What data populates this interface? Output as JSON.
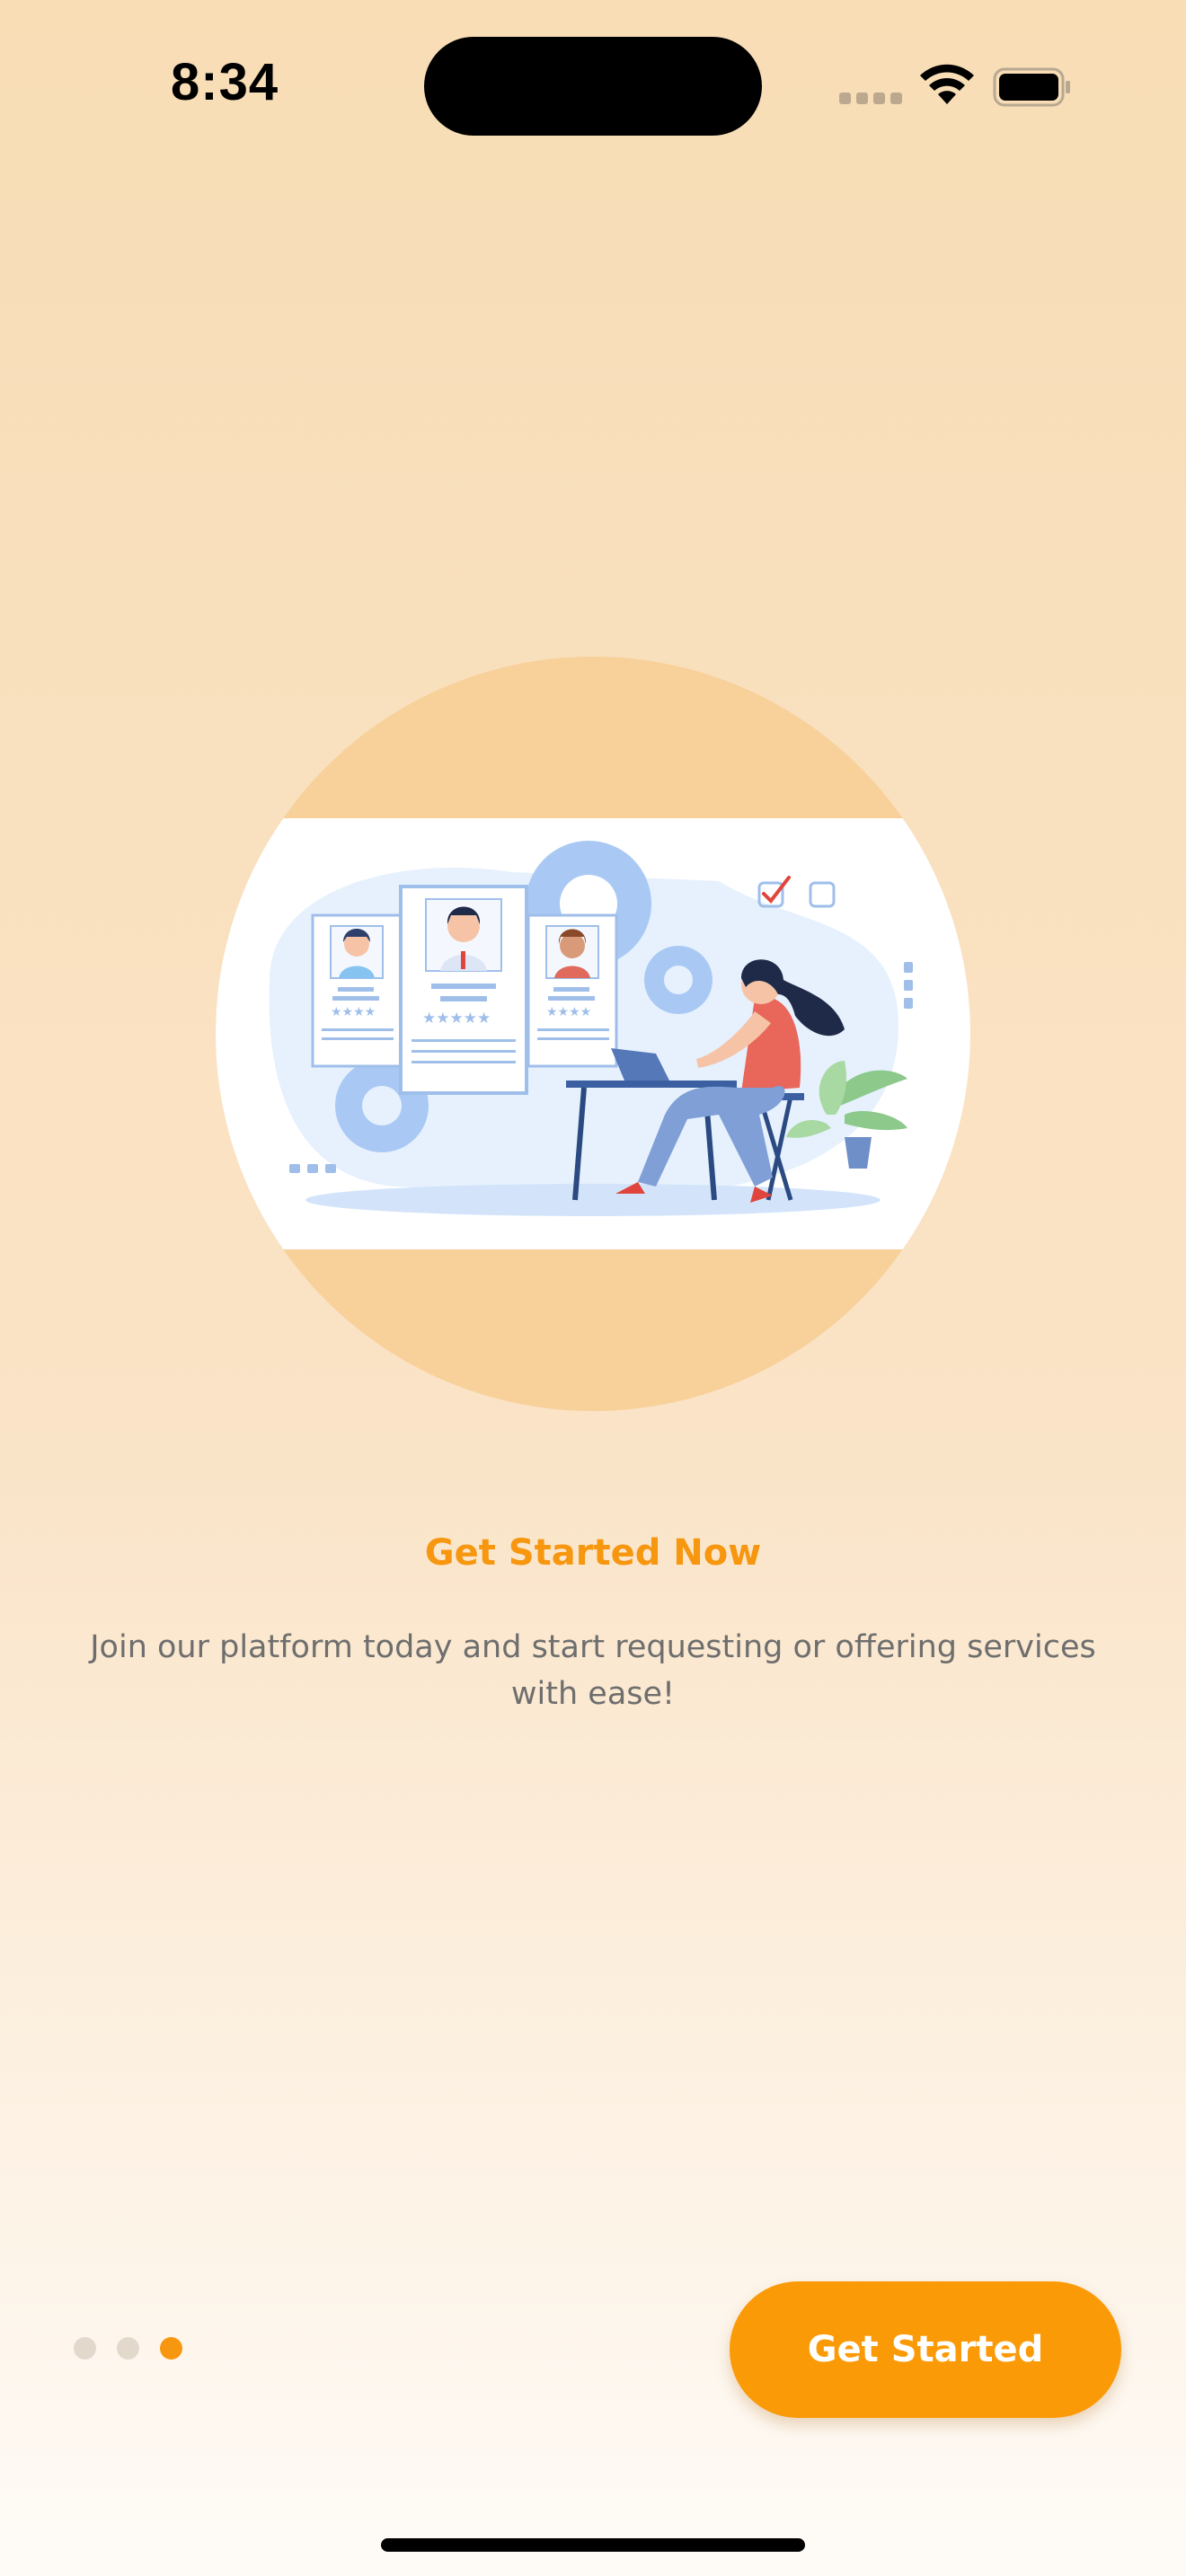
{
  "status_bar": {
    "time": "8:34"
  },
  "onboarding": {
    "title": "Get Started Now",
    "description": "Join our platform today and start requesting or offering services with ease!",
    "page_count": 3,
    "current_page": 3,
    "cta_label": "Get Started"
  },
  "colors": {
    "accent": "#F7960F",
    "button": "#FB9A07",
    "hero_circle": "#F8D09A",
    "background_top": "#F8DDB5",
    "background_bottom": "#FEFBF7"
  },
  "illustration": {
    "subject": "woman-working-on-laptop-with-candidate-profile-cards",
    "icons": [
      "gear-icon",
      "checkbox-checked-icon",
      "checkbox-empty-icon",
      "plant-icon"
    ]
  }
}
